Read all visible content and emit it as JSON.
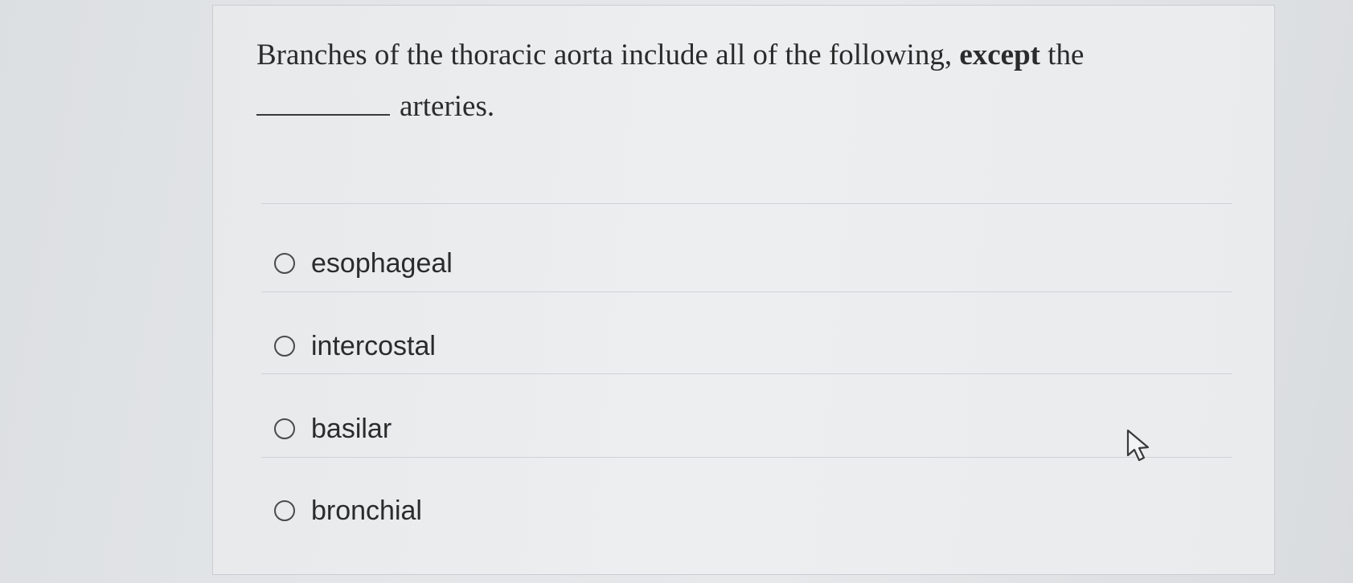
{
  "question": {
    "text_before": "Branches of the thoracic aorta include all of the following,",
    "emphasis": "except",
    "text_after": "the",
    "line2_after_blank": "arteries."
  },
  "options": [
    {
      "label": "esophageal"
    },
    {
      "label": "intercostal"
    },
    {
      "label": "basilar"
    },
    {
      "label": "bronchial"
    }
  ],
  "cursor_icon": "mouse-pointer-icon"
}
